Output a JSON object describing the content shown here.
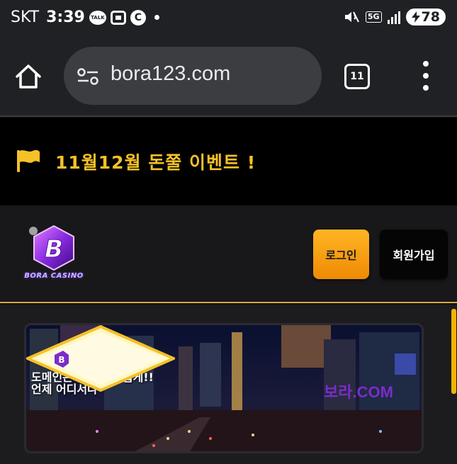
{
  "status_bar": {
    "carrier": "SKT",
    "time": "3:39",
    "talk_label": "TALK",
    "network": "5G",
    "battery": "78"
  },
  "browser": {
    "url": "bora123.com",
    "tab_count": "11"
  },
  "notice": {
    "text": "11월12월 돈쭐 이벤트 !"
  },
  "header": {
    "logo_text": "BORA CASINO",
    "login_label": "로그인",
    "signup_label": "회원가입"
  },
  "banner": {
    "line1": "도메인은 기억하기 쉽게!!",
    "line2": "언제 어디서나",
    "badge_text": "보라.COM"
  },
  "colors": {
    "accent_gold": "#f5c129",
    "login_orange": "#f59e0b",
    "brand_purple": "#7b2cc9"
  }
}
